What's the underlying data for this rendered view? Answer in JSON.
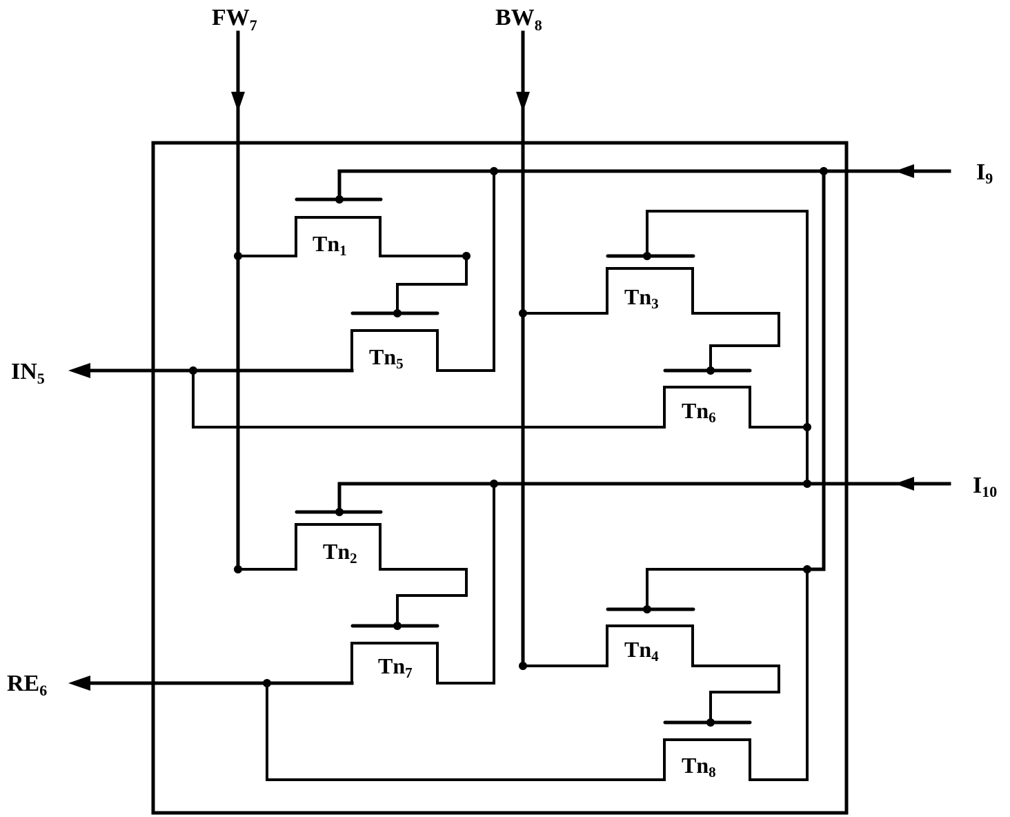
{
  "diagram": {
    "type": "circuit-schematic",
    "colors": {
      "line": "#000000",
      "background": "#ffffff"
    },
    "ports": {
      "fw": {
        "base": "FW",
        "sub": "7",
        "direction": "input"
      },
      "bw": {
        "base": "BW",
        "sub": "8",
        "direction": "input"
      },
      "i9": {
        "base": "I",
        "sub": "9",
        "direction": "input"
      },
      "i10": {
        "base": "I",
        "sub": "10",
        "direction": "input"
      },
      "in5": {
        "base": "IN",
        "sub": "5",
        "direction": "output"
      },
      "re6": {
        "base": "RE",
        "sub": "6",
        "direction": "output"
      }
    },
    "transistors": {
      "tn1": {
        "base": "Tn",
        "sub": "1"
      },
      "tn2": {
        "base": "Tn",
        "sub": "2"
      },
      "tn3": {
        "base": "Tn",
        "sub": "3"
      },
      "tn4": {
        "base": "Tn",
        "sub": "4"
      },
      "tn5": {
        "base": "Tn",
        "sub": "5"
      },
      "tn6": {
        "base": "Tn",
        "sub": "6"
      },
      "tn7": {
        "base": "Tn",
        "sub": "7"
      },
      "tn8": {
        "base": "Tn",
        "sub": "8"
      }
    }
  }
}
